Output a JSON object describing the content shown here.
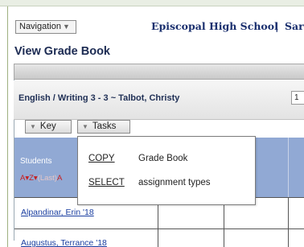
{
  "header": {
    "nav_label": "Navigation",
    "school_name": "Episcopal High School",
    "school_sep": "|",
    "school_trunc": "Sar"
  },
  "page": {
    "title": "View Grade Book"
  },
  "course": {
    "title": "English / Writing 3 - 3 ~ Talbot, Christy",
    "term_value": "1"
  },
  "toolbar": {
    "key_label": "Key",
    "tasks_label": "Tasks"
  },
  "grid": {
    "students_header": "Students",
    "sort": {
      "az": "A▾Z▾",
      "last": "(Last)",
      "a2": "A"
    },
    "students": [
      "Alpandinar, Erin '18",
      "Augustus, Terrance '18"
    ]
  },
  "tasks_menu": {
    "items": [
      {
        "keyword": "COPY",
        "text": "Grade Book"
      },
      {
        "keyword": "SELECT",
        "text": "assignment types"
      }
    ]
  }
}
